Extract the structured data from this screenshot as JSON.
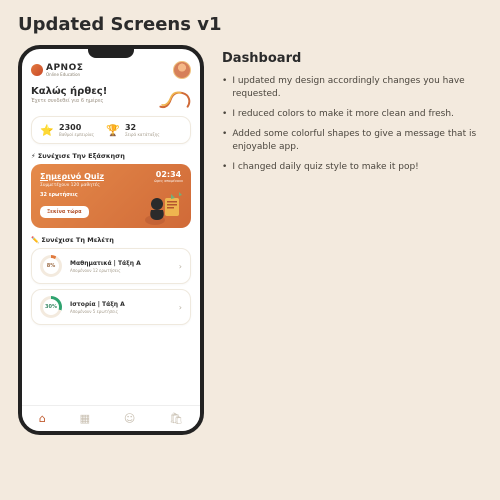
{
  "page": {
    "title": "Updated Screens v1"
  },
  "right": {
    "heading": "Dashboard",
    "bullets": [
      "I updated my design accordingly changes you have requested.",
      "I reduced colors to make it more clean and fresh.",
      "Added some colorful shapes to give a message that is enjoyable app.",
      "I changed daily quiz style to make it pop!"
    ]
  },
  "app": {
    "brand": {
      "name": "ΑΡΝΟΣ",
      "tagline": "Online Education"
    },
    "welcome": {
      "title": "Καλώς ήρθες!",
      "subtitle": "Έχετε συνδεθεί για 6 ημέρες"
    },
    "stats": [
      {
        "icon": "⭐",
        "value": "2300",
        "label": "Βαθμοί εμπειρίας"
      },
      {
        "icon": "🏆",
        "value": "32",
        "label": "Σειρά κατάταξης"
      }
    ],
    "practice": {
      "heading": "⚡ Συνέχισε Την Εξάσκηση",
      "quiz": {
        "title": "Σημερινό Quiz",
        "subtitle": "Συμμετέχουν 120 μαθητές",
        "questions": "32 ερωτήσεις",
        "cta": "Ξεκίνα τώρα",
        "timer": "02:34",
        "timer_label": "ώρες\nαπομένουν"
      }
    },
    "study": {
      "heading": "✏️ Συνέχισε Τη Μελέτη",
      "items": [
        {
          "pct": "8%",
          "title": "Μαθηματικά | Τάξη Α",
          "subtitle": "Απομένουν 12 ερωτήσεις"
        },
        {
          "pct": "30%",
          "title": "Ιστορία | Τάξη Α",
          "subtitle": "Απομένουν 5 ερωτήσεις"
        }
      ]
    },
    "tabs": {
      "home": "⌂",
      "grid": "▦",
      "user": "☺",
      "bag": "🛍"
    }
  }
}
